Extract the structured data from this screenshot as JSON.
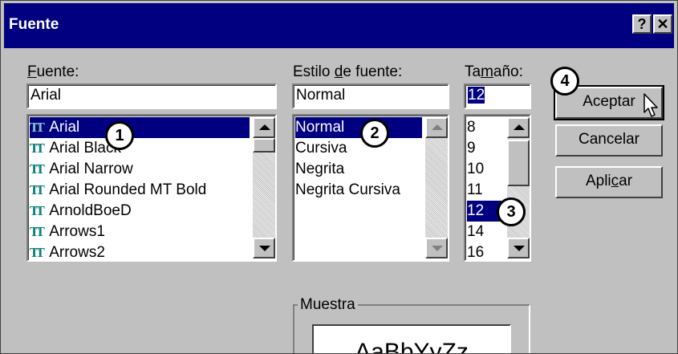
{
  "window": {
    "title": "Fuente",
    "help_btn": "?",
    "close_btn": "✕"
  },
  "font": {
    "label": "Fuente:",
    "value": "Arial",
    "items": [
      "Arial",
      "Arial Black",
      "Arial Narrow",
      "Arial Rounded MT Bold",
      "ArnoldBoeD",
      "Arrows1",
      "Arrows2"
    ],
    "selected": "Arial"
  },
  "style": {
    "label": "Estilo de fuente:",
    "value": "Normal",
    "items": [
      "Normal",
      "Cursiva",
      "Negrita",
      "Negrita Cursiva"
    ],
    "selected": "Normal"
  },
  "size": {
    "label": "Tamaño:",
    "value": "12",
    "items": [
      "8",
      "9",
      "10",
      "11",
      "12",
      "14",
      "16"
    ],
    "selected": "12"
  },
  "buttons": {
    "ok": "Aceptar",
    "cancel": "Cancelar",
    "apply": "Aplicar"
  },
  "sample": {
    "label": "Muestra",
    "text": "AaBbYyZz"
  },
  "callouts": [
    "1",
    "2",
    "3",
    "4"
  ]
}
